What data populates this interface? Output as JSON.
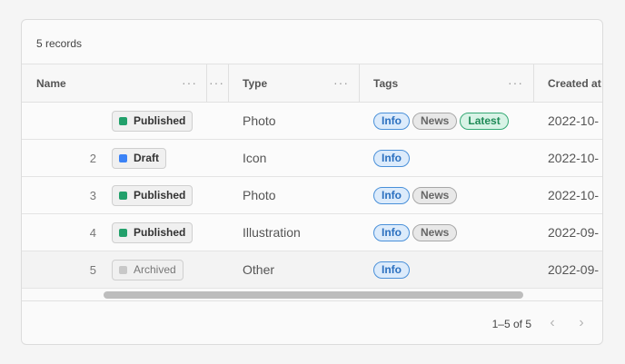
{
  "records_label": "5 records",
  "columns": {
    "name": "Name",
    "type": "Type",
    "tags": "Tags",
    "created": "Created at"
  },
  "menu_glyph": "···",
  "rows": [
    {
      "name": "",
      "status": "Published",
      "status_color": "#22a06b",
      "type": "Photo",
      "tags": [
        "Info",
        "News",
        "Latest"
      ],
      "created": "2022-10-"
    },
    {
      "name": "2",
      "status": "Draft",
      "status_color": "#3b82f6",
      "type": "Icon",
      "tags": [
        "Info"
      ],
      "created": "2022-10-"
    },
    {
      "name": "3",
      "status": "Published",
      "status_color": "#22a06b",
      "type": "Photo",
      "tags": [
        "Info",
        "News"
      ],
      "created": "2022-10-"
    },
    {
      "name": "4",
      "status": "Published",
      "status_color": "#22a06b",
      "type": "Illustration",
      "tags": [
        "Info",
        "News"
      ],
      "created": "2022-09-"
    },
    {
      "name": "5",
      "status": "Archived",
      "status_color": "#c8c8c8",
      "type": "Other",
      "tags": [
        "Info"
      ],
      "created": "2022-09-"
    }
  ],
  "pagination": {
    "range": "1–5 of 5",
    "prev_glyph": "‹",
    "next_glyph": "›"
  }
}
